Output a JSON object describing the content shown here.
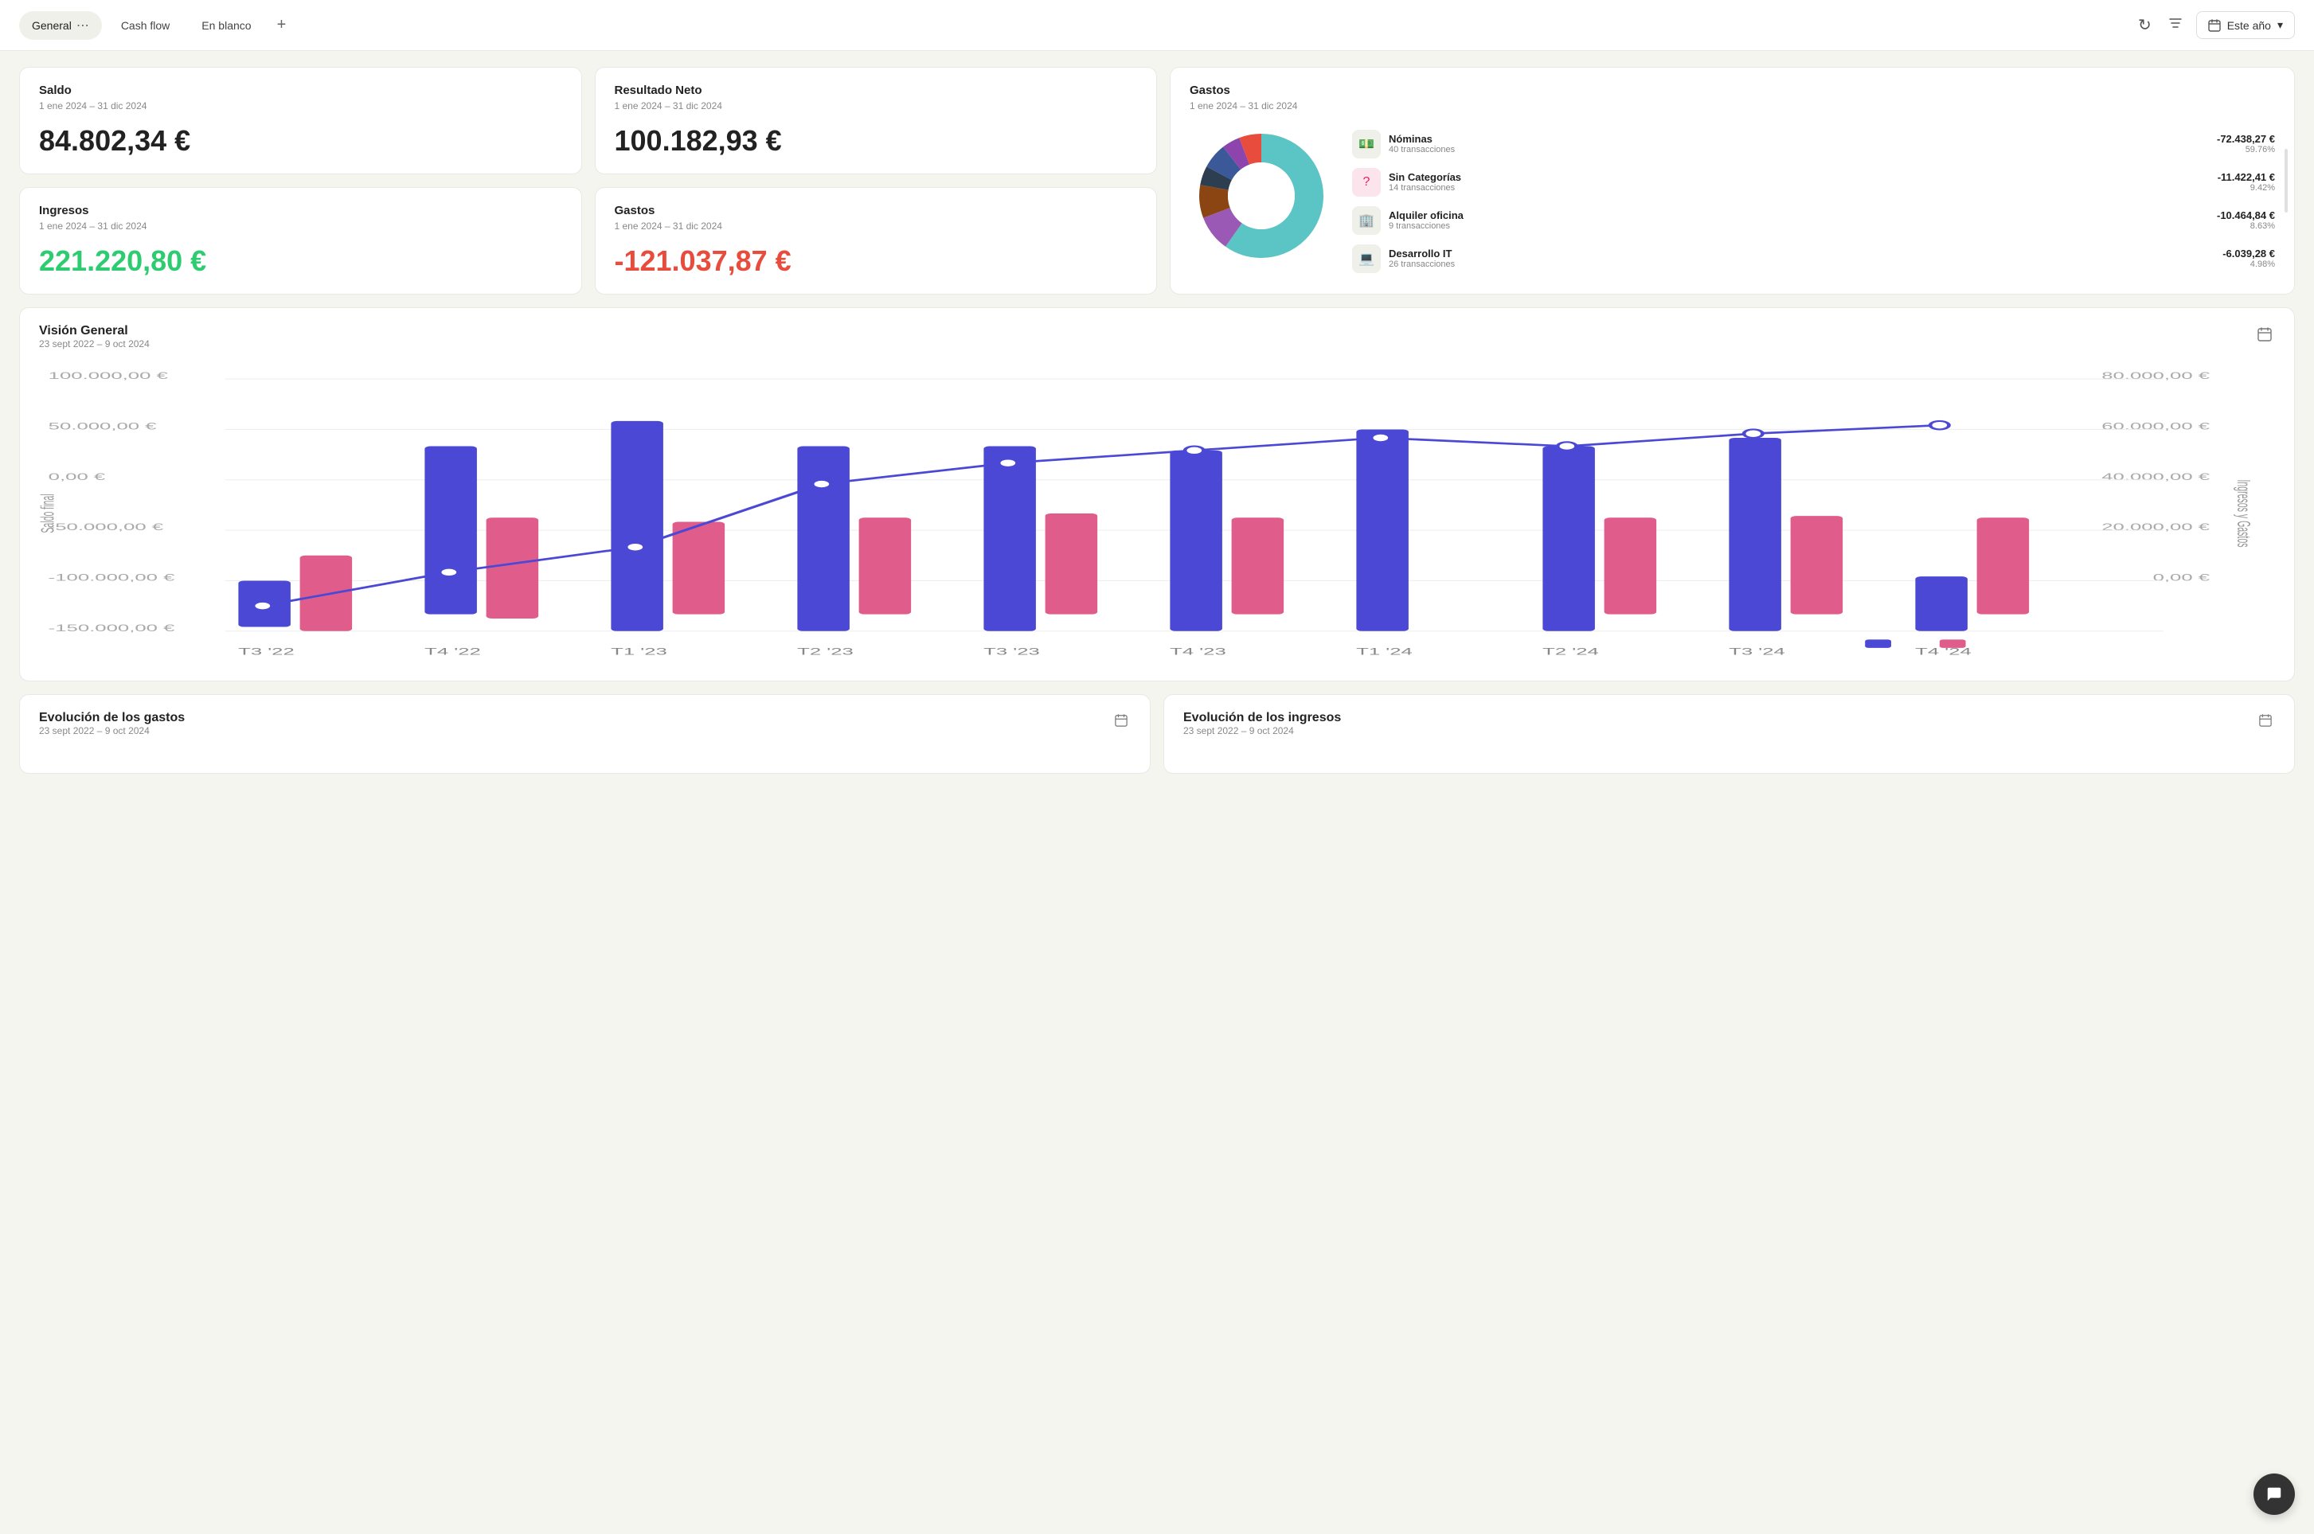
{
  "nav": {
    "tabs": [
      {
        "id": "general",
        "label": "General",
        "active": true,
        "hasMenu": true
      },
      {
        "id": "cashflow",
        "label": "Cash flow",
        "active": false
      },
      {
        "id": "enblanco",
        "label": "En blanco",
        "active": false
      }
    ],
    "addLabel": "+",
    "refreshIcon": "↻",
    "filterIcon": "⊟",
    "calendarIcon": "📅",
    "dateLabel": "Este año",
    "chevronDown": "▾"
  },
  "cards": {
    "saldo": {
      "title": "Saldo",
      "date": "1 ene 2024 – 31 dic 2024",
      "value": "84.802,34 €"
    },
    "resultado": {
      "title": "Resultado Neto",
      "date": "1 ene 2024 – 31 dic 2024",
      "value": "100.182,93 €"
    },
    "ingresos": {
      "title": "Ingresos",
      "date": "1 ene 2024 – 31 dic 2024",
      "value": "221.220,80 €"
    },
    "gastos_small": {
      "title": "Gastos",
      "date": "1 ene 2024 – 31 dic 2024",
      "value": "-121.037,87 €"
    },
    "gastos_big": {
      "title": "Gastos",
      "date": "1 ene 2024 – 31 dic 2024",
      "items": [
        {
          "icon": "💵",
          "name": "Nóminas",
          "transactions": "40 transacciones",
          "amount": "-72.438,27 €",
          "pct": "59.76%",
          "color": "#5BC4C4"
        },
        {
          "icon": "❓",
          "name": "Sin Categorías",
          "transactions": "14 transacciones",
          "amount": "-11.422,41 €",
          "pct": "9.42%",
          "color": "#9B59B6"
        },
        {
          "icon": "🏢",
          "name": "Alquiler oficina",
          "transactions": "9 transacciones",
          "amount": "-10.464,84 €",
          "pct": "8.63%",
          "color": "#8B4513"
        },
        {
          "icon": "💻",
          "name": "Desarrollo IT",
          "transactions": "26 transacciones",
          "amount": "-6.039,28 €",
          "pct": "4.98%",
          "color": "#2C3E50"
        }
      ]
    }
  },
  "vision": {
    "title": "Visión General",
    "date": "23 sept 2022 – 9 oct 2024",
    "yLeftLabel": "Saldo final",
    "yRightLabel": "Ingresos y Gastos",
    "yLeftTicks": [
      "100.000,00 €",
      "50.000,00 €",
      "0,00 €",
      "-50.000,00 €",
      "-100.000,00 €",
      "-150.000,00 €"
    ],
    "yRightTicks": [
      "80.000,00 €",
      "60.000,00 €",
      "40.000,00 €",
      "20.000,00 €",
      "0,00 €"
    ],
    "xLabels": [
      "T3 '22",
      "T4 '22",
      "T1 '23",
      "T2 '23",
      "T3 '23",
      "T4 '23",
      "T1 '24",
      "T2 '24",
      "T3 '24",
      "T4 '24"
    ],
    "bars": [
      {
        "q": "T3 '22",
        "blue": 15,
        "red": 25
      },
      {
        "q": "T4 '22",
        "blue": 55,
        "red": 35
      },
      {
        "q": "T1 '23",
        "blue": 70,
        "red": 30
      },
      {
        "q": "T2 '23",
        "blue": 60,
        "red": 32
      },
      {
        "q": "T3 '23",
        "blue": 60,
        "red": 35
      },
      {
        "q": "T4 '23",
        "blue": 58,
        "red": 30
      },
      {
        "q": "T1 '24",
        "blue": 75,
        "red": 0
      },
      {
        "q": "T2 '24",
        "blue": 58,
        "red": 32
      },
      {
        "q": "T3 '24",
        "blue": 62,
        "red": 30
      },
      {
        "q": "T4 '24",
        "blue": 12,
        "red": 30
      }
    ],
    "linePoints": [
      -110,
      -75,
      -45,
      20,
      40,
      55,
      60,
      50,
      65,
      75
    ]
  },
  "bottom": {
    "gastos_evol": {
      "title": "Evolución de los gastos",
      "date": "23 sept 2022 – 9 oct 2024"
    },
    "ingresos_evol": {
      "title": "Evolución de los ingresos",
      "date": "23 sept 2022 – 9 oct 2024"
    }
  }
}
